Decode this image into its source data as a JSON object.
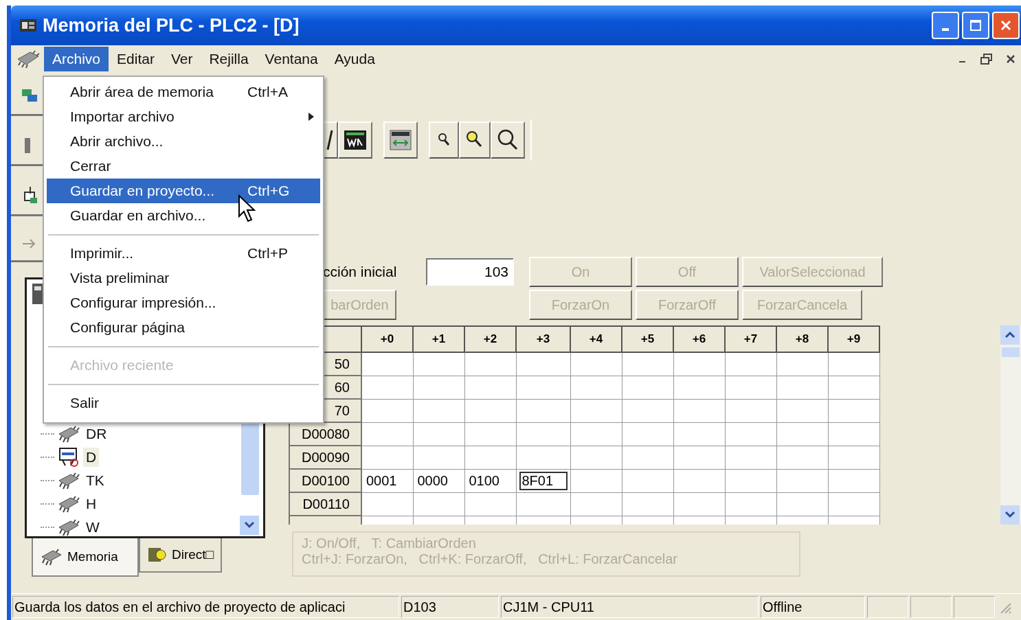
{
  "window": {
    "title": "Memoria del PLC - PLC2 - [D]"
  },
  "menu_bar": [
    {
      "label": "Archivo",
      "selected": true
    },
    {
      "label": "Editar",
      "selected": false
    },
    {
      "label": "Ver",
      "selected": false
    },
    {
      "label": "Rejilla",
      "selected": false
    },
    {
      "label": "Ventana",
      "selected": false
    },
    {
      "label": "Ayuda",
      "selected": false
    }
  ],
  "archivo_menu": [
    {
      "kind": "item",
      "label": "Abrir área de memoria",
      "shortcut": "Ctrl+A",
      "selected": false,
      "disabled": false
    },
    {
      "kind": "submenu",
      "label": "Importar archivo",
      "selected": false,
      "disabled": false
    },
    {
      "kind": "item",
      "label": "Abrir archivo...",
      "selected": false,
      "disabled": false
    },
    {
      "kind": "item",
      "label": "Cerrar",
      "selected": false,
      "disabled": false
    },
    {
      "kind": "item",
      "label": "Guardar en proyecto...",
      "shortcut": "Ctrl+G",
      "selected": true,
      "disabled": false
    },
    {
      "kind": "item",
      "label": "Guardar en archivo...",
      "selected": false,
      "disabled": false
    },
    {
      "kind": "separator"
    },
    {
      "kind": "item",
      "label": "Imprimir...",
      "shortcut": "Ctrl+P",
      "selected": false,
      "disabled": false
    },
    {
      "kind": "item",
      "label": "Vista preliminar",
      "selected": false,
      "disabled": false
    },
    {
      "kind": "item",
      "label": "Configurar impresión...",
      "selected": false,
      "disabled": false
    },
    {
      "kind": "item",
      "label": "Configurar página",
      "selected": false,
      "disabled": false
    },
    {
      "kind": "separator"
    },
    {
      "kind": "item",
      "label": "Archivo reciente",
      "selected": false,
      "disabled": true
    },
    {
      "kind": "separator"
    },
    {
      "kind": "item",
      "label": "Salir",
      "selected": false,
      "disabled": false
    }
  ],
  "tree": {
    "items": [
      {
        "kind": "chip",
        "label": "DR",
        "selected": false
      },
      {
        "kind": "monitor",
        "label": "D",
        "selected": true
      },
      {
        "kind": "chip",
        "label": "TK",
        "selected": false
      },
      {
        "kind": "chip",
        "label": "H",
        "selected": false
      },
      {
        "kind": "chip",
        "label": "W",
        "selected": false
      }
    ]
  },
  "panel_tabs": [
    {
      "label": "Memoria",
      "selected": true
    },
    {
      "label": "Direct□",
      "selected": false
    }
  ],
  "address": {
    "label": "cción inicial",
    "value": "103"
  },
  "buttons_row_1": [
    {
      "label": "On",
      "disabled": true
    },
    {
      "label": "Off",
      "disabled": true
    },
    {
      "label": "ValorSeleccionad",
      "disabled": true
    }
  ],
  "order_button": {
    "label": "barOrden",
    "disabled": true
  },
  "buttons_row_2": [
    {
      "label": "ForzarOn",
      "disabled": true
    },
    {
      "label": "ForzarOff",
      "disabled": true
    },
    {
      "label": "ForzarCancela",
      "disabled": true
    }
  ],
  "grid": {
    "columns": [
      "+0",
      "+1",
      "+2",
      "+3",
      "+4",
      "+5",
      "+6",
      "+7",
      "+8",
      "+9"
    ],
    "rows": [
      {
        "label": "50"
      },
      {
        "label": "60"
      },
      {
        "label": "70"
      },
      {
        "label": "D00080"
      },
      {
        "label": "D00090"
      },
      {
        "label": "D00100",
        "cells": [
          {
            "value": "0001",
            "selected": false
          },
          {
            "value": "0000",
            "selected": false
          },
          {
            "value": "0100",
            "selected": false
          },
          {
            "value": "8F01",
            "selected": true
          }
        ]
      },
      {
        "label": "D00110"
      }
    ]
  },
  "hint": {
    "disabled": true,
    "lines": [
      "J: On/Off,   T: CambiarOrden",
      "Ctrl+J: ForzarOn,   Ctrl+K: ForzarOff,   Ctrl+L: ForzarCancelar"
    ]
  },
  "status_bar": [
    "Guarda los datos en el archivo de proyecto de aplicaci",
    "D103",
    "CJ1M - CPU11",
    "Offline"
  ]
}
